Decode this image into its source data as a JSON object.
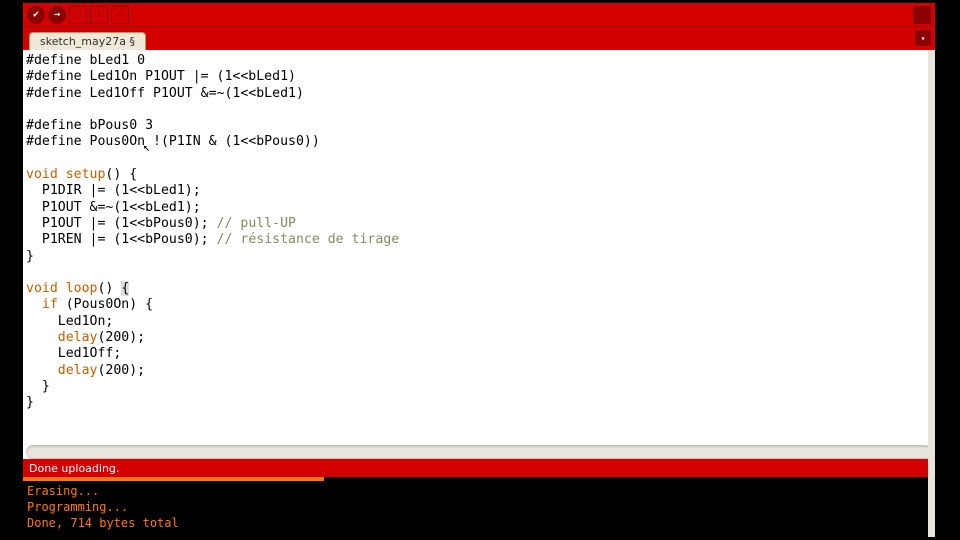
{
  "tab": {
    "name": "sketch_may27a §"
  },
  "toolbar": {
    "verify_icon": "✔",
    "upload_icon": "→",
    "new_icon": "▢",
    "open_icon": "↑",
    "save_icon": "↓",
    "serial_icon": "◧"
  },
  "tab_dropdown": "▾",
  "code": {
    "l1": "#define bLed1 0",
    "l2": "#define Led1On P1OUT |= (1<<bLed1)",
    "l3": "#define Led1Off P1OUT &=~(1<<bLed1)",
    "l4": "",
    "l5": "#define bPous0 3",
    "l6a": "#define Pous0On",
    "l6b": " !(P1IN & (1<<bPous0))",
    "l7": "",
    "kw_void": "void",
    "fn_setup": "setup",
    "paren_open": "() {",
    "l9": "  P1DIR |= (1<<bLed1);",
    "l10": "  P1OUT &=~(1<<bLed1);",
    "l11a": "  P1OUT |= (1<<bPous0); ",
    "l11c": "// pull-UP",
    "l12a": "  P1REN |= (1<<bPous0); ",
    "l12c": "// résistance de tirage",
    "l13": "}",
    "fn_loop": "loop",
    "loop_open": "() ",
    "brace_hl": "{",
    "kw_if": "if",
    "l16b": " (Pous0On) {",
    "l17": "    Led1On;",
    "fn_delay": "delay",
    "l18a": "    ",
    "l18b": "(200);",
    "l19": "    Led1Off;",
    "l20a": "    ",
    "l20b": "(200);",
    "l21": "  }",
    "l22": "}"
  },
  "status": {
    "text": "Done uploading."
  },
  "console": {
    "line1": "Erasing...",
    "line2": "Programming...",
    "line3": "Done, 714 bytes total"
  }
}
